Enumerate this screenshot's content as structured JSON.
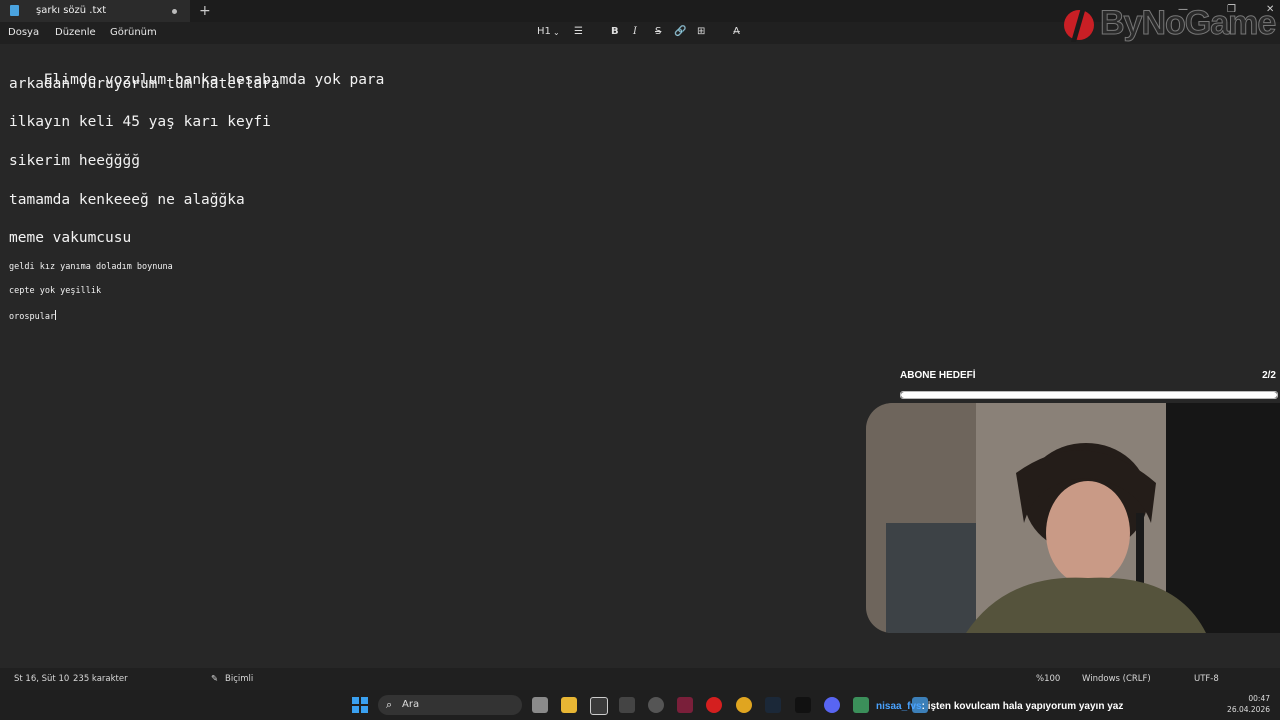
{
  "window": {
    "tab_title": "şarkı sözü .txt",
    "new_tab": "+"
  },
  "branding": {
    "logo_text": "ByNoGame"
  },
  "window_controls": {
    "minimize": "—",
    "maximize": "❐",
    "close": "✕"
  },
  "menu": {
    "file": "Dosya",
    "edit": "Düzenle",
    "view": "Görünüm"
  },
  "format_toolbar": {
    "heading": "H1",
    "list": "☰",
    "bold": "B",
    "italic": "I",
    "strike": "S",
    "link": "🔗",
    "table": "⊞",
    "clear": "A̶"
  },
  "document": {
    "heading_lines": [
      "Elimde vozulum banka hesabımda yok para",
      "arkadan vuruyorum tüm haterlara",
      "ilkayın keli 45 yaş karı keyfi",
      "sikerim heeğğğğ",
      "tamamda kenkeeeğ ne alağğka",
      "meme vakumcusu"
    ],
    "body_lines": [
      "geldi kız yanıma doladım boynuna",
      "cepte yok yeşillik",
      "orospular"
    ]
  },
  "overlay": {
    "goal_title": "ABONE HEDEFİ",
    "goal_count": "2/2",
    "goal_progress": 1.0
  },
  "status": {
    "position": "St 16, Süt 10",
    "characters": "235 karakter",
    "format": "Biçimli",
    "zoom": "%100",
    "line_endings": "Windows (CRLF)",
    "encoding": "UTF-8"
  },
  "taskbar": {
    "search_placeholder": "Ara",
    "ticker_user": "nisaa_fvs",
    "ticker_message": ": işten kovulcam hala yapıyorum yayın yaz",
    "time": "00:47",
    "date": "26.04.2026"
  },
  "colors": {
    "accent": "#3aa0f0",
    "spell_error": "#d23b3b"
  }
}
